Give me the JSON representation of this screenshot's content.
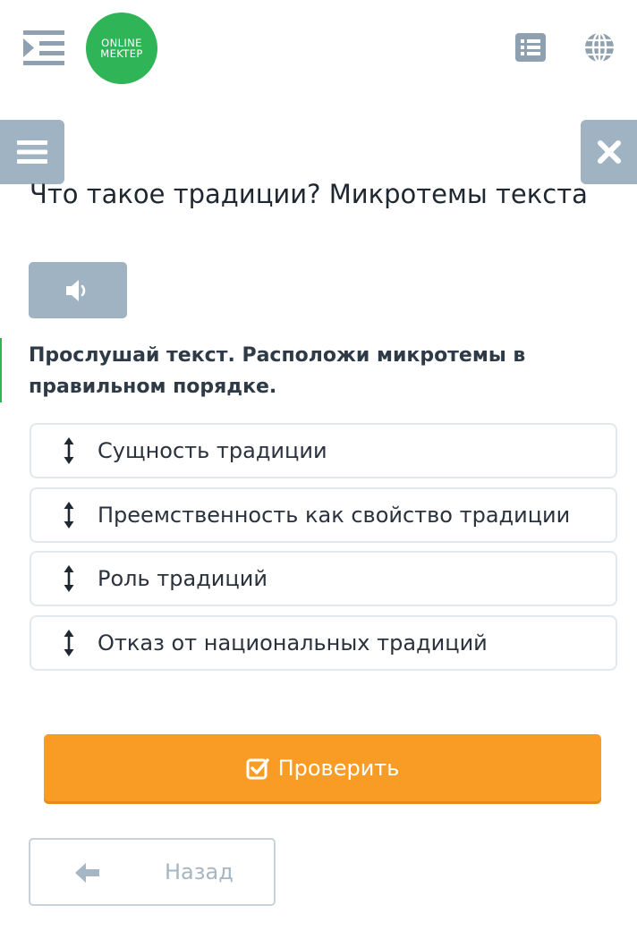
{
  "header": {
    "logo_line1": "Online",
    "logo_line2": "Mektep",
    "menu_icon": "indent-menu-icon",
    "list_icon": "list-icon",
    "language_icon": "globe-icon",
    "brand_color": "#2fb457"
  },
  "side": {
    "menu_icon": "hamburger-icon",
    "close_icon": "close-icon"
  },
  "main": {
    "title": "Что такое традиции? Микротемы текста",
    "audio_icon": "speaker-icon",
    "instruction": "Прослушай текст. Расположи микротемы в правильном порядке.",
    "items": [
      {
        "label": "Сущность традиции"
      },
      {
        "label": "Преемственность как свойство традиции"
      },
      {
        "label": "Роль традиций"
      },
      {
        "label": "Отказ от национальных традиций"
      }
    ],
    "check_label": "Проверить",
    "back_label": "Назад"
  },
  "colors": {
    "accent": "#f99c25",
    "muted_button": "#9fb3c2",
    "item_border": "#e3e8ec"
  }
}
